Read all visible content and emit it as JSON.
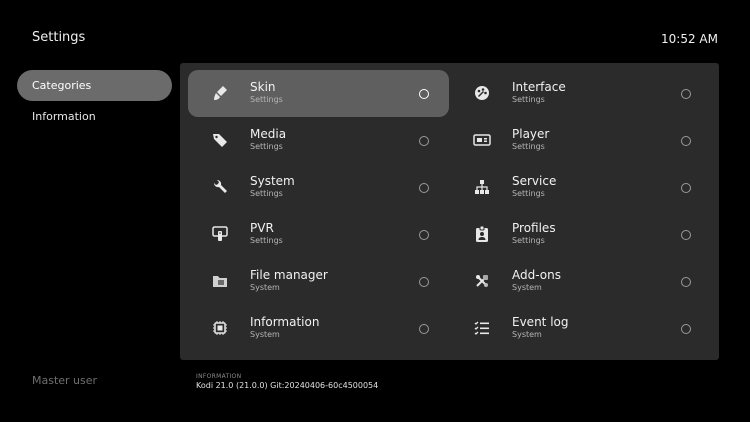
{
  "header": {
    "title": "Settings",
    "time": "10:52 AM"
  },
  "sidebar": {
    "items": [
      {
        "label": "Categories"
      },
      {
        "label": "Information"
      }
    ],
    "user": "Master user"
  },
  "tiles": [
    {
      "label": "Skin",
      "sub": "Settings",
      "icon": "paintbrush-icon"
    },
    {
      "label": "Interface",
      "sub": "Settings",
      "icon": "palette-icon"
    },
    {
      "label": "Media",
      "sub": "Settings",
      "icon": "tags-icon"
    },
    {
      "label": "Player",
      "sub": "Settings",
      "icon": "player-icon"
    },
    {
      "label": "System",
      "sub": "Settings",
      "icon": "wrench-icon"
    },
    {
      "label": "Service",
      "sub": "Settings",
      "icon": "network-icon"
    },
    {
      "label": "PVR",
      "sub": "Settings",
      "icon": "tv-remote-icon"
    },
    {
      "label": "Profiles",
      "sub": "Settings",
      "icon": "badge-icon"
    },
    {
      "label": "File manager",
      "sub": "System",
      "icon": "folder-icon"
    },
    {
      "label": "Add-ons",
      "sub": "System",
      "icon": "addons-icon"
    },
    {
      "label": "Information",
      "sub": "System",
      "icon": "chip-icon"
    },
    {
      "label": "Event log",
      "sub": "System",
      "icon": "list-icon"
    }
  ],
  "footer": {
    "label": "INFORMATION",
    "value": "Kodi 21.0 (21.0.0) Git:20240406-60c4500054"
  }
}
